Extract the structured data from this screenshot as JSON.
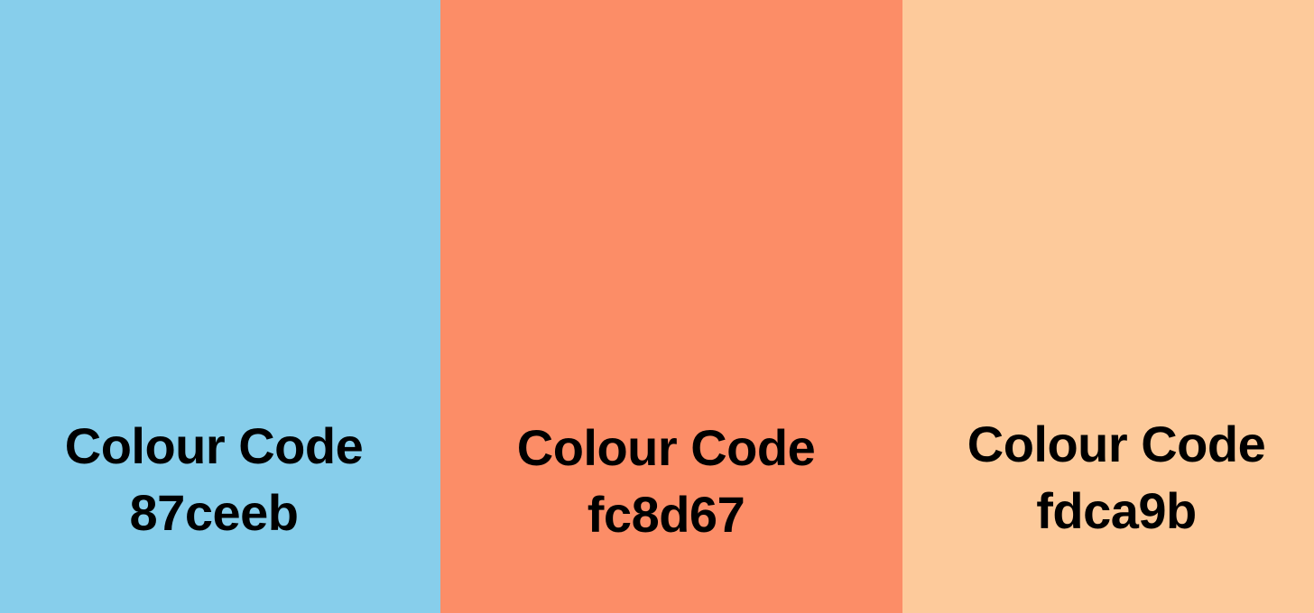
{
  "swatches": [
    {
      "color": "#87ceeb",
      "heading": "Colour Code",
      "code": "87ceeb"
    },
    {
      "color": "#fc8d67",
      "heading": "Colour Code",
      "code": "fc8d67"
    },
    {
      "color": "#fdca9b",
      "heading": "Colour Code",
      "code": "fdca9b"
    }
  ]
}
